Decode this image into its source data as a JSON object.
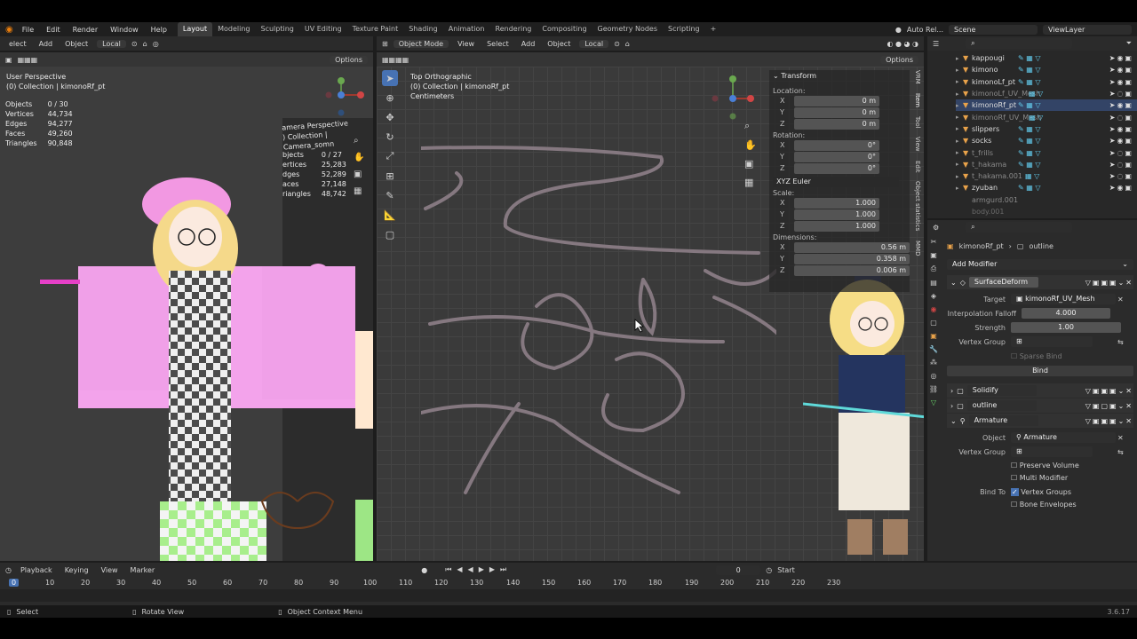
{
  "topbar": {
    "menus": [
      "File",
      "Edit",
      "Render",
      "Window",
      "Help"
    ],
    "workspaces": [
      "Layout",
      "Modeling",
      "Sculpting",
      "UV Editing",
      "Texture Paint",
      "Shading",
      "Animation",
      "Rendering",
      "Compositing",
      "Geometry Nodes",
      "Scripting"
    ],
    "active_workspace": "Layout",
    "add_tab": "+",
    "auto_rel": "Auto Rel...",
    "scene": "Scene",
    "view_layer": "ViewLayer"
  },
  "left_view": {
    "header": {
      "select": "elect",
      "add": "Add",
      "object": "Object",
      "orientation": "Local",
      "options": "Options"
    },
    "title": "User Perspective",
    "collection": "(0) Collection | kimonoRf_pt",
    "stats": [
      {
        "label": "Objects",
        "value": "0 / 30"
      },
      {
        "label": "Vertices",
        "value": "44,734"
      },
      {
        "label": "Edges",
        "value": "94,277"
      },
      {
        "label": "Faces",
        "value": "49,260"
      },
      {
        "label": "Triangles",
        "value": "90,848"
      }
    ],
    "camera": {
      "title": "amera Perspective",
      "collection": ") Collection | Camera_somn",
      "stats": [
        {
          "label": "bjects",
          "value": "0 / 27"
        },
        {
          "label": "ertices",
          "value": "25,283"
        },
        {
          "label": "dges",
          "value": "52,289"
        },
        {
          "label": "aces",
          "value": "27,148"
        },
        {
          "label": "riangles",
          "value": "48,742"
        }
      ]
    }
  },
  "right_view": {
    "header": {
      "mode": "Object Mode",
      "view": "View",
      "select": "Select",
      "add": "Add",
      "object": "Object",
      "orientation": "Local",
      "options": "Options"
    },
    "title": "Top Orthographic",
    "collection": "(0) Collection | kimonoRf_pt",
    "units": "Centimeters",
    "side_tabs": [
      "VRM",
      "Item",
      "Tool",
      "View",
      "Edit",
      "Object statistics",
      "MMD"
    ]
  },
  "transform": {
    "title": "Transform",
    "location_label": "Location:",
    "location": [
      {
        "axis": "X",
        "value": "0 m"
      },
      {
        "axis": "Y",
        "value": "0 m"
      },
      {
        "axis": "Z",
        "value": "0 m"
      }
    ],
    "rotation_label": "Rotation:",
    "rotation": [
      {
        "axis": "X",
        "value": "0°"
      },
      {
        "axis": "Y",
        "value": "0°"
      },
      {
        "axis": "Z",
        "value": "0°"
      }
    ],
    "rotation_mode": "XYZ Euler",
    "scale_label": "Scale:",
    "scale": [
      {
        "axis": "X",
        "value": "1.000"
      },
      {
        "axis": "Y",
        "value": "1.000"
      },
      {
        "axis": "Z",
        "value": "1.000"
      }
    ],
    "dimensions_label": "Dimensions:",
    "dimensions": [
      {
        "axis": "X",
        "value": "0.56 m"
      },
      {
        "axis": "Y",
        "value": "0.358 m"
      },
      {
        "axis": "Z",
        "value": "0.006 m"
      }
    ]
  },
  "outliner": {
    "items": [
      {
        "name": "kappougi",
        "dim": false
      },
      {
        "name": "kimono",
        "dim": false
      },
      {
        "name": "kimonoLf_pt",
        "dim": false
      },
      {
        "name": "kimonoLf_UV_Mesh",
        "dim": true
      },
      {
        "name": "kimonoRf_pt",
        "dim": false
      },
      {
        "name": "kimonoRf_UV_Mesh",
        "dim": true
      },
      {
        "name": "slippers",
        "dim": false
      },
      {
        "name": "socks",
        "dim": false
      },
      {
        "name": "t_frills",
        "dim": true
      },
      {
        "name": "t_hakama",
        "dim": true
      },
      {
        "name": "t_hakama.001",
        "dim": true
      },
      {
        "name": "zyuban",
        "dim": false
      },
      {
        "name": "armgurd.001",
        "dim": true
      },
      {
        "name": "body.001",
        "dim": true
      }
    ]
  },
  "properties": {
    "breadcrumb_object": "kimonoRf_pt",
    "breadcrumb_modifier": "outline",
    "add_modifier": "Add Modifier",
    "surface_deform": {
      "name": "SurfaceDeform",
      "target_label": "Target",
      "target": "kimonoRf_UV_Mesh",
      "falloff_label": "Interpolation Falloff",
      "falloff": "4.000",
      "strength_label": "Strength",
      "strength": "1.00",
      "vgroup_label": "Vertex Group",
      "sparse_bind": "Sparse Bind",
      "bind": "Bind"
    },
    "solidify": "Solidify",
    "outline": "outline",
    "armature": {
      "name": "Armature",
      "object_label": "Object",
      "object": "Armature",
      "vgroup_label": "Vertex Group",
      "preserve_volume": "Preserve Volume",
      "multi_modifier": "Multi Modifier",
      "bind_to_label": "Bind To",
      "vertex_groups": "Vertex Groups",
      "bone_envelopes": "Bone Envelopes"
    }
  },
  "timeline": {
    "menus": [
      "Playback",
      "Keying",
      "View",
      "Marker"
    ],
    "current_frame": "0",
    "start_label": "Start",
    "ticks": [
      "0",
      "10",
      "20",
      "30",
      "40",
      "50",
      "60",
      "70",
      "80",
      "90",
      "100",
      "110",
      "120",
      "130",
      "140",
      "150",
      "160",
      "170",
      "180",
      "190",
      "200",
      "210",
      "220",
      "230"
    ]
  },
  "statusbar": {
    "select": "Select",
    "rotate": "Rotate View",
    "context": "Object Context Menu",
    "version": "3.6.17"
  }
}
